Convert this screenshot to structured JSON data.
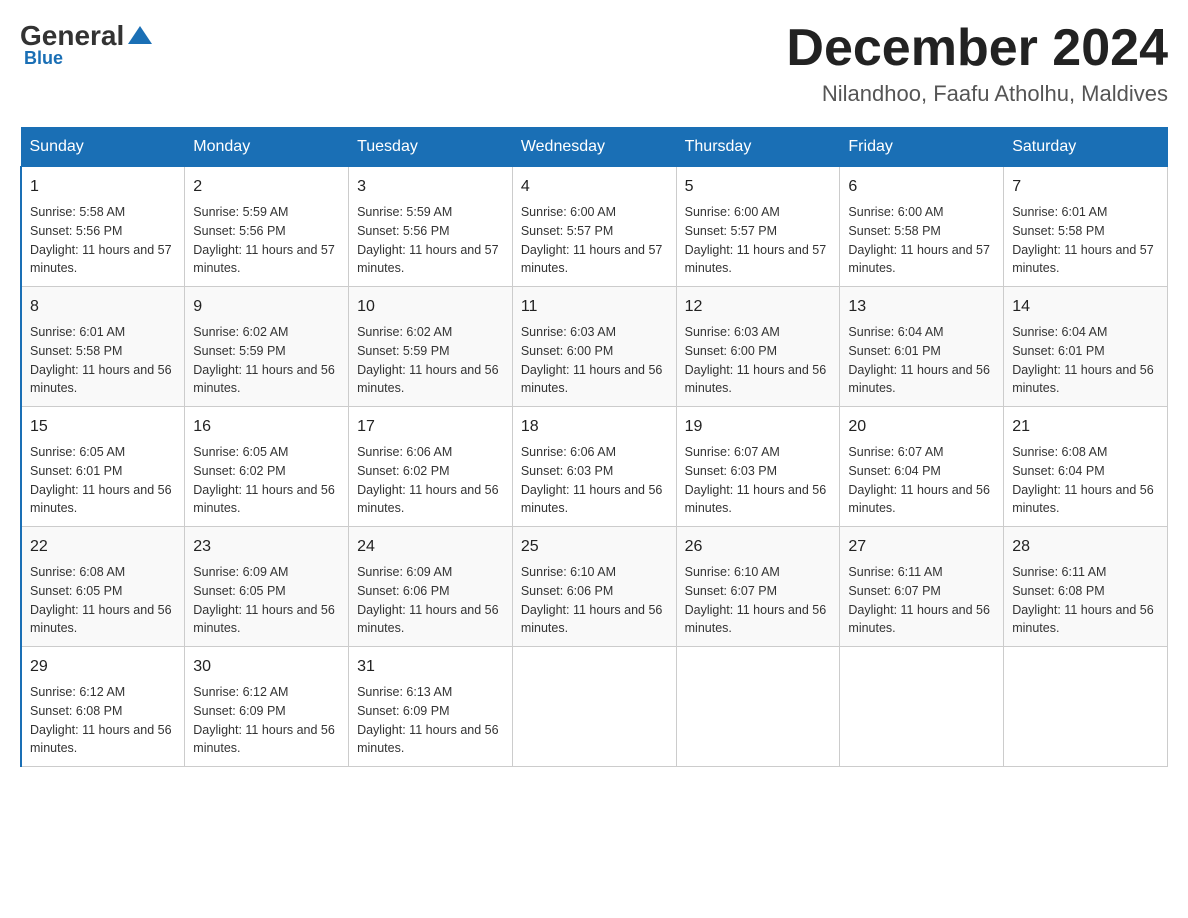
{
  "header": {
    "logo": {
      "general": "General",
      "blue": "Blue",
      "sub": "Blue"
    },
    "title": "December 2024",
    "location": "Nilandhoo, Faafu Atholhu, Maldives"
  },
  "weekdays": [
    "Sunday",
    "Monday",
    "Tuesday",
    "Wednesday",
    "Thursday",
    "Friday",
    "Saturday"
  ],
  "weeks": [
    [
      {
        "day": "1",
        "sunrise": "Sunrise: 5:58 AM",
        "sunset": "Sunset: 5:56 PM",
        "daylight": "Daylight: 11 hours and 57 minutes."
      },
      {
        "day": "2",
        "sunrise": "Sunrise: 5:59 AM",
        "sunset": "Sunset: 5:56 PM",
        "daylight": "Daylight: 11 hours and 57 minutes."
      },
      {
        "day": "3",
        "sunrise": "Sunrise: 5:59 AM",
        "sunset": "Sunset: 5:56 PM",
        "daylight": "Daylight: 11 hours and 57 minutes."
      },
      {
        "day": "4",
        "sunrise": "Sunrise: 6:00 AM",
        "sunset": "Sunset: 5:57 PM",
        "daylight": "Daylight: 11 hours and 57 minutes."
      },
      {
        "day": "5",
        "sunrise": "Sunrise: 6:00 AM",
        "sunset": "Sunset: 5:57 PM",
        "daylight": "Daylight: 11 hours and 57 minutes."
      },
      {
        "day": "6",
        "sunrise": "Sunrise: 6:00 AM",
        "sunset": "Sunset: 5:58 PM",
        "daylight": "Daylight: 11 hours and 57 minutes."
      },
      {
        "day": "7",
        "sunrise": "Sunrise: 6:01 AM",
        "sunset": "Sunset: 5:58 PM",
        "daylight": "Daylight: 11 hours and 57 minutes."
      }
    ],
    [
      {
        "day": "8",
        "sunrise": "Sunrise: 6:01 AM",
        "sunset": "Sunset: 5:58 PM",
        "daylight": "Daylight: 11 hours and 56 minutes."
      },
      {
        "day": "9",
        "sunrise": "Sunrise: 6:02 AM",
        "sunset": "Sunset: 5:59 PM",
        "daylight": "Daylight: 11 hours and 56 minutes."
      },
      {
        "day": "10",
        "sunrise": "Sunrise: 6:02 AM",
        "sunset": "Sunset: 5:59 PM",
        "daylight": "Daylight: 11 hours and 56 minutes."
      },
      {
        "day": "11",
        "sunrise": "Sunrise: 6:03 AM",
        "sunset": "Sunset: 6:00 PM",
        "daylight": "Daylight: 11 hours and 56 minutes."
      },
      {
        "day": "12",
        "sunrise": "Sunrise: 6:03 AM",
        "sunset": "Sunset: 6:00 PM",
        "daylight": "Daylight: 11 hours and 56 minutes."
      },
      {
        "day": "13",
        "sunrise": "Sunrise: 6:04 AM",
        "sunset": "Sunset: 6:01 PM",
        "daylight": "Daylight: 11 hours and 56 minutes."
      },
      {
        "day": "14",
        "sunrise": "Sunrise: 6:04 AM",
        "sunset": "Sunset: 6:01 PM",
        "daylight": "Daylight: 11 hours and 56 minutes."
      }
    ],
    [
      {
        "day": "15",
        "sunrise": "Sunrise: 6:05 AM",
        "sunset": "Sunset: 6:01 PM",
        "daylight": "Daylight: 11 hours and 56 minutes."
      },
      {
        "day": "16",
        "sunrise": "Sunrise: 6:05 AM",
        "sunset": "Sunset: 6:02 PM",
        "daylight": "Daylight: 11 hours and 56 minutes."
      },
      {
        "day": "17",
        "sunrise": "Sunrise: 6:06 AM",
        "sunset": "Sunset: 6:02 PM",
        "daylight": "Daylight: 11 hours and 56 minutes."
      },
      {
        "day": "18",
        "sunrise": "Sunrise: 6:06 AM",
        "sunset": "Sunset: 6:03 PM",
        "daylight": "Daylight: 11 hours and 56 minutes."
      },
      {
        "day": "19",
        "sunrise": "Sunrise: 6:07 AM",
        "sunset": "Sunset: 6:03 PM",
        "daylight": "Daylight: 11 hours and 56 minutes."
      },
      {
        "day": "20",
        "sunrise": "Sunrise: 6:07 AM",
        "sunset": "Sunset: 6:04 PM",
        "daylight": "Daylight: 11 hours and 56 minutes."
      },
      {
        "day": "21",
        "sunrise": "Sunrise: 6:08 AM",
        "sunset": "Sunset: 6:04 PM",
        "daylight": "Daylight: 11 hours and 56 minutes."
      }
    ],
    [
      {
        "day": "22",
        "sunrise": "Sunrise: 6:08 AM",
        "sunset": "Sunset: 6:05 PM",
        "daylight": "Daylight: 11 hours and 56 minutes."
      },
      {
        "day": "23",
        "sunrise": "Sunrise: 6:09 AM",
        "sunset": "Sunset: 6:05 PM",
        "daylight": "Daylight: 11 hours and 56 minutes."
      },
      {
        "day": "24",
        "sunrise": "Sunrise: 6:09 AM",
        "sunset": "Sunset: 6:06 PM",
        "daylight": "Daylight: 11 hours and 56 minutes."
      },
      {
        "day": "25",
        "sunrise": "Sunrise: 6:10 AM",
        "sunset": "Sunset: 6:06 PM",
        "daylight": "Daylight: 11 hours and 56 minutes."
      },
      {
        "day": "26",
        "sunrise": "Sunrise: 6:10 AM",
        "sunset": "Sunset: 6:07 PM",
        "daylight": "Daylight: 11 hours and 56 minutes."
      },
      {
        "day": "27",
        "sunrise": "Sunrise: 6:11 AM",
        "sunset": "Sunset: 6:07 PM",
        "daylight": "Daylight: 11 hours and 56 minutes."
      },
      {
        "day": "28",
        "sunrise": "Sunrise: 6:11 AM",
        "sunset": "Sunset: 6:08 PM",
        "daylight": "Daylight: 11 hours and 56 minutes."
      }
    ],
    [
      {
        "day": "29",
        "sunrise": "Sunrise: 6:12 AM",
        "sunset": "Sunset: 6:08 PM",
        "daylight": "Daylight: 11 hours and 56 minutes."
      },
      {
        "day": "30",
        "sunrise": "Sunrise: 6:12 AM",
        "sunset": "Sunset: 6:09 PM",
        "daylight": "Daylight: 11 hours and 56 minutes."
      },
      {
        "day": "31",
        "sunrise": "Sunrise: 6:13 AM",
        "sunset": "Sunset: 6:09 PM",
        "daylight": "Daylight: 11 hours and 56 minutes."
      },
      null,
      null,
      null,
      null
    ]
  ]
}
